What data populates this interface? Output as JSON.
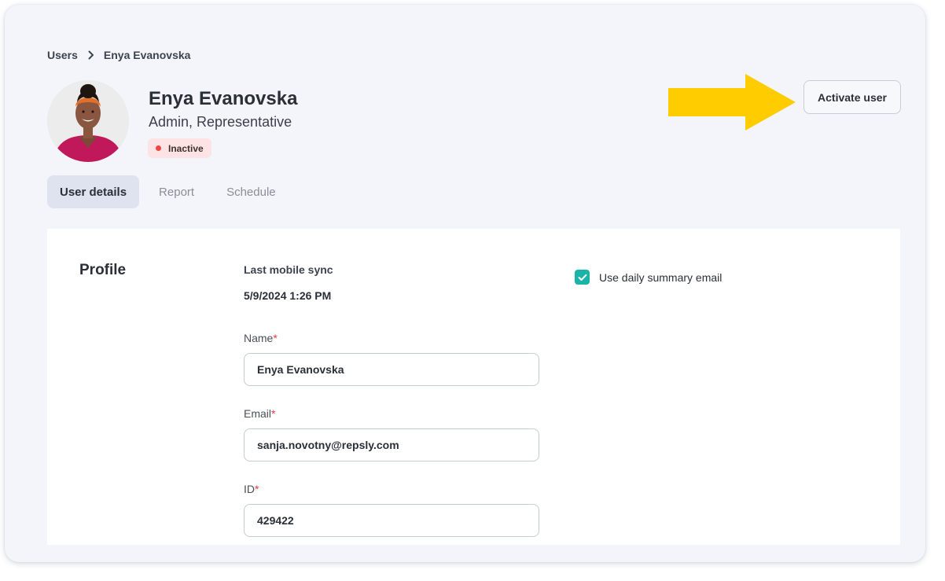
{
  "breadcrumb": {
    "parent": "Users",
    "current": "Enya Evanovska"
  },
  "user": {
    "name": "Enya Evanovska",
    "roles": "Admin, Representative",
    "status": "Inactive"
  },
  "actions": {
    "activate_label": "Activate user"
  },
  "tabs": [
    {
      "label": "User details",
      "active": true
    },
    {
      "label": "Report",
      "active": false
    },
    {
      "label": "Schedule",
      "active": false
    }
  ],
  "profile": {
    "section_title": "Profile",
    "last_sync_label": "Last mobile sync",
    "last_sync_value": "5/9/2024 1:26 PM",
    "name_label": "Name",
    "name_value": "Enya Evanovska",
    "email_label": "Email",
    "email_value": "sanja.novotny@repsly.com",
    "id_label": "ID",
    "id_value": "429422",
    "required_mark": "*",
    "daily_summary_label": "Use daily summary email",
    "daily_summary_checked": true
  },
  "colors": {
    "accent": "#19b3a7",
    "status_inactive": "#f0444b",
    "status_badge_bg": "#fde3e3",
    "annotation_arrow": "#ffcc00",
    "required": "#e03b3b"
  }
}
